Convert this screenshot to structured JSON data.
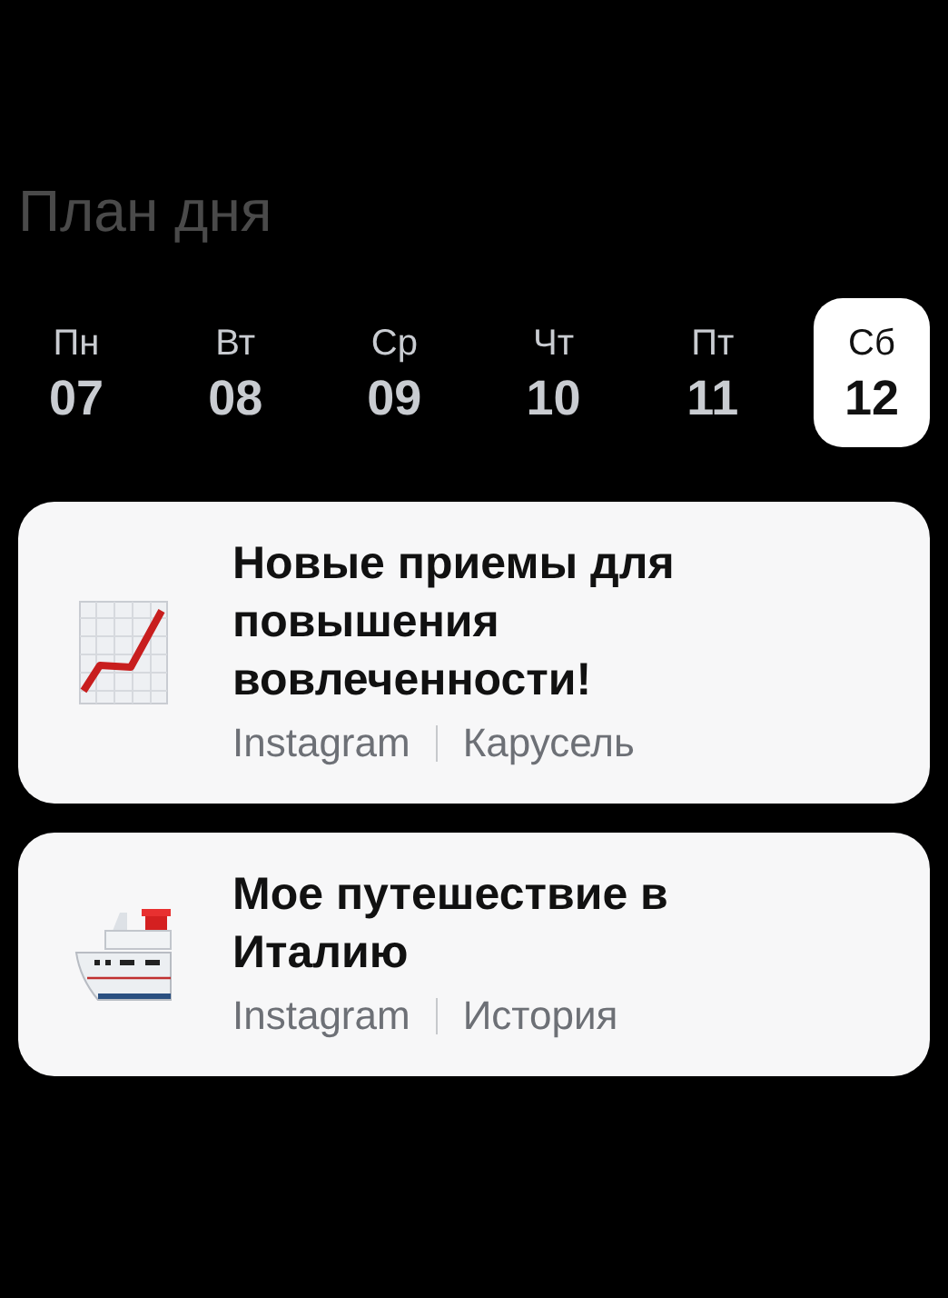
{
  "title": "План дня",
  "days": [
    {
      "weekday": "Пн",
      "date": "07",
      "selected": false
    },
    {
      "weekday": "Вт",
      "date": "08",
      "selected": false
    },
    {
      "weekday": "Ср",
      "date": "09",
      "selected": false
    },
    {
      "weekday": "Чт",
      "date": "10",
      "selected": false
    },
    {
      "weekday": "Пт",
      "date": "11",
      "selected": false
    },
    {
      "weekday": "Сб",
      "date": "12",
      "selected": true
    }
  ],
  "posts": [
    {
      "kind": "chart",
      "title": "Новые приемы для повышения вовлеченности!",
      "platform": "Instagram",
      "format": "Карусель"
    },
    {
      "kind": "ship",
      "title": "Мое путешествие в Италию",
      "platform": "Instagram",
      "format": "История"
    }
  ]
}
